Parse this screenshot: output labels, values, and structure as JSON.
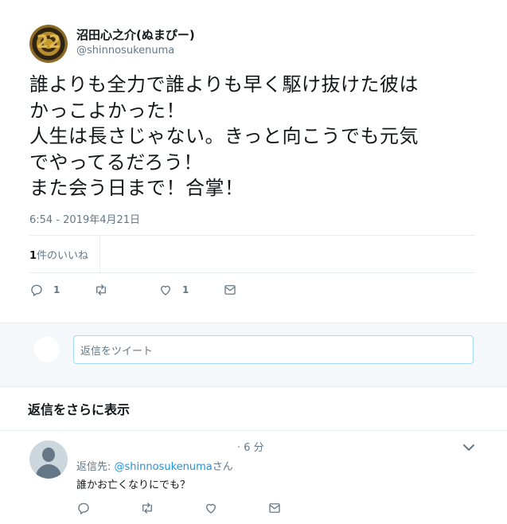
{
  "tweet": {
    "display_name": "沼田心之介(ぬまぴー)",
    "screen_name": "@shinnosukenuma",
    "avatar_glyph": "22",
    "text_lines": [
      "誰よりも全力で誰よりも早く駆け抜けた彼は",
      "かっこよかった！",
      "人生は長さじゃない。きっと向こうでも元気",
      "でやってるだろう！",
      "また会う日まで！合掌！"
    ],
    "timestamp": "6:54 - 2019年4月21日",
    "likes_count": "1",
    "likes_label": "件のいいね",
    "actions": {
      "reply_count": "1",
      "retweet_count": "",
      "like_count": "1"
    }
  },
  "compose": {
    "placeholder": "返信をツイート"
  },
  "more_replies_label": "返信をさらに表示",
  "reply": {
    "time": "· 6 分",
    "reply_to_prefix": "返信先: ",
    "reply_to_mention": "@shinnosukenuma",
    "reply_to_suffix": "さん",
    "text": "誰かお亡くなりにでも？",
    "actions": {
      "reply_count": "",
      "retweet_count": "",
      "like_count": ""
    }
  },
  "icons": {
    "reply": "reply-icon",
    "retweet": "retweet-icon",
    "like": "heart-icon",
    "dm": "envelope-icon",
    "caret": "chevron-down-icon"
  },
  "colors": {
    "link": "#1b95e0",
    "muted": "#657786",
    "text": "#14171a",
    "border": "#e6ecf0",
    "compose_bg": "#f5f8fa"
  }
}
